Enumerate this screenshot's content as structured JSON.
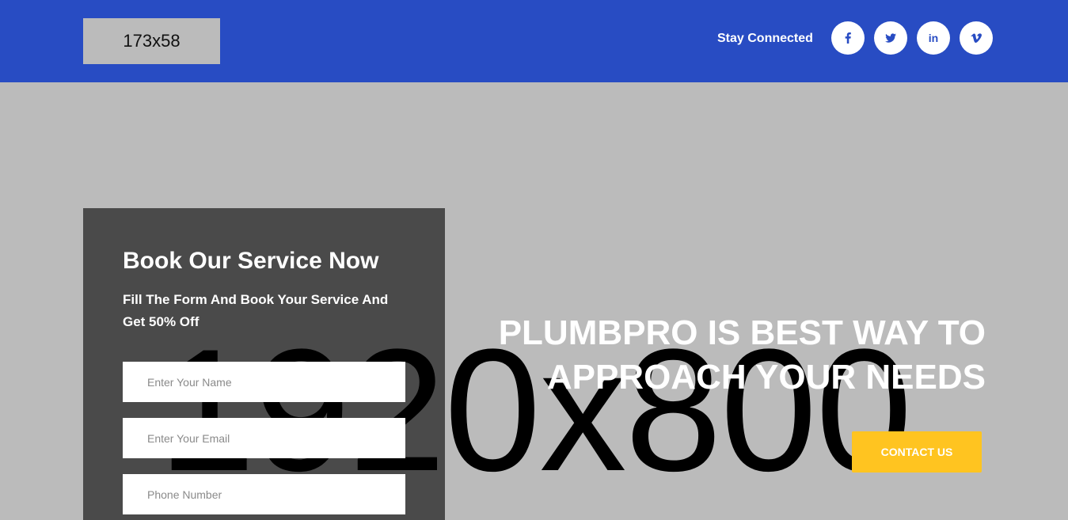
{
  "header": {
    "logo_placeholder": "173x58",
    "stay_connected": "Stay Connected",
    "social": [
      {
        "name": "facebook-icon",
        "glyph": "f"
      },
      {
        "name": "twitter-icon",
        "glyph": "twitter"
      },
      {
        "name": "linkedin-icon",
        "glyph": "in"
      },
      {
        "name": "vimeo-icon",
        "glyph": "v"
      }
    ],
    "bg_color": "#284cc3"
  },
  "hero": {
    "bg_placeholder": "1920x800",
    "title_line1": "PLUMBPRO IS BEST WAY TO",
    "title_line2": "APPROACH YOUR NEEDS",
    "cta_label": "CONTACT US",
    "cta_color": "#ffc420"
  },
  "booking": {
    "title": "Book Our Service Now",
    "subtitle": "Fill The Form And Book Your Service And Get 50% Off",
    "fields": {
      "name_placeholder": "Enter Your Name",
      "email_placeholder": "Enter Your Email",
      "phone_placeholder": "Phone Number"
    }
  }
}
